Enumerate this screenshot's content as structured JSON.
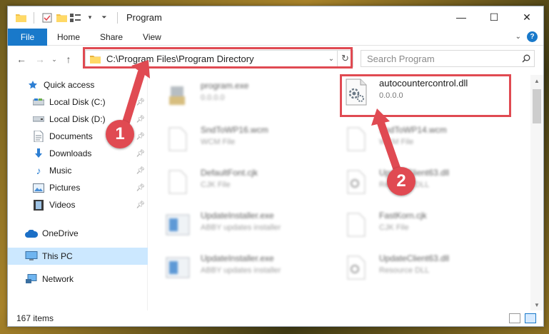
{
  "window": {
    "title": "Program",
    "controls": {
      "minimize": "—",
      "maximize": "☐",
      "close": "✕"
    }
  },
  "ribbon": {
    "file_label": "File",
    "tabs": [
      "Home",
      "Share",
      "View"
    ]
  },
  "navbar": {
    "address": "C:\\Program Files\\Program Directory",
    "search_placeholder": "Search Program"
  },
  "sidebar": {
    "items": [
      {
        "label": "Quick access",
        "icon": "star-icon",
        "pinned": false
      },
      {
        "label": "Local Disk (C:)",
        "icon": "drive-icon",
        "pinned": true
      },
      {
        "label": "Local Disk (D:)",
        "icon": "drive-icon",
        "pinned": true
      },
      {
        "label": "Documents",
        "icon": "documents-icon",
        "pinned": true
      },
      {
        "label": "Downloads",
        "icon": "download-icon",
        "pinned": true
      },
      {
        "label": "Music",
        "icon": "music-icon",
        "pinned": true
      },
      {
        "label": "Pictures",
        "icon": "pictures-icon",
        "pinned": true
      },
      {
        "label": "Videos",
        "icon": "videos-icon",
        "pinned": true
      },
      {
        "label": "OneDrive",
        "icon": "cloud-icon",
        "pinned": false
      },
      {
        "label": "This PC",
        "icon": "pc-icon",
        "pinned": false,
        "selected": true
      },
      {
        "label": "Network",
        "icon": "network-icon",
        "pinned": false
      }
    ]
  },
  "files": [
    {
      "name": "program.exe",
      "desc": "0.0.0.0",
      "icon": "exe-icon",
      "blurred": true
    },
    {
      "name": "autocountercontrol.dll",
      "desc": "0.0.0.0",
      "icon": "dll-gear-icon",
      "blurred": false
    },
    {
      "name": "SndToWP16.wcm",
      "desc": "WCM File",
      "icon": "blank-file-icon",
      "blurred": true
    },
    {
      "name": "SndToWP14.wcm",
      "desc": "WCM File",
      "icon": "blank-file-icon",
      "blurred": true
    },
    {
      "name": "DefaultFont.cjk",
      "desc": "CJK File",
      "icon": "blank-file-icon",
      "blurred": true
    },
    {
      "name": "UpdateClient63.dll",
      "desc": "Resource DLL",
      "icon": "dll-gear-icon",
      "blurred": true
    },
    {
      "name": "UpdateInstaller.exe",
      "desc": "ABBY updates installer",
      "icon": "installer-icon",
      "blurred": true
    },
    {
      "name": "FastKorn.cjk",
      "desc": "CJK File",
      "icon": "blank-file-icon",
      "blurred": true
    },
    {
      "name": "UpdateInstaller.exe",
      "desc": "ABBY updates installer",
      "icon": "installer-icon",
      "blurred": true
    },
    {
      "name": "UpdateClient63.dll",
      "desc": "Resource DLL",
      "icon": "dll-gear-icon",
      "blurred": true
    }
  ],
  "status": {
    "count": "167 items"
  },
  "annotations": {
    "step1": "1",
    "step2": "2"
  },
  "colors": {
    "accent": "#1979ca",
    "annotation": "#e04a52",
    "selected": "#cce8ff"
  }
}
